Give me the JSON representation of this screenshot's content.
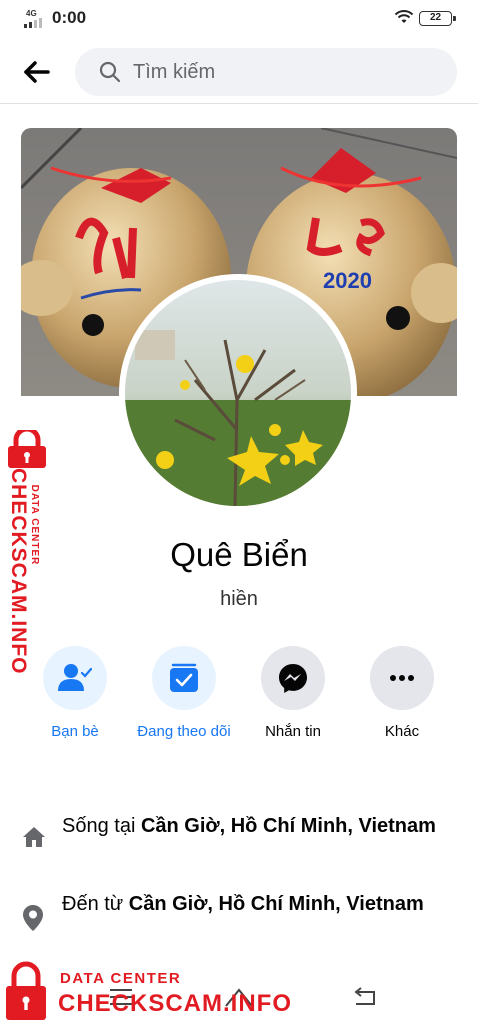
{
  "status_bar": {
    "network": "4G",
    "time": "0:00",
    "battery": "22"
  },
  "search": {
    "placeholder": "Tìm kiếm"
  },
  "profile": {
    "name": "Quê Biển",
    "bio": "hiền"
  },
  "actions": [
    {
      "label": "Bạn bè",
      "icon": "friends-icon",
      "style": "blue"
    },
    {
      "label": "Đang theo dõi",
      "icon": "following-icon",
      "style": "blue"
    },
    {
      "label": "Nhắn tin",
      "icon": "messenger-icon",
      "style": "grey"
    },
    {
      "label": "Khác",
      "icon": "more-icon",
      "style": "grey"
    }
  ],
  "details": {
    "lives_in": {
      "prefix": "Sống tại ",
      "place": "Cần Giờ, Hồ Chí Minh, Vietnam",
      "icon": "home-icon"
    },
    "from": {
      "prefix": "Đến từ ",
      "place": "Cần Giờ, Hồ Chí Minh, Vietnam",
      "icon": "location-pin-icon"
    }
  },
  "watermark": {
    "top_line": "DATA CENTER",
    "main_line": "CHECKSCAM.INFO"
  },
  "cover_text": {
    "year": "2020"
  },
  "colors": {
    "accent": "#1877f2",
    "accent_light": "#e7f3ff",
    "button_grey": "#e4e6eb",
    "watermark_red": "#e21b23"
  }
}
